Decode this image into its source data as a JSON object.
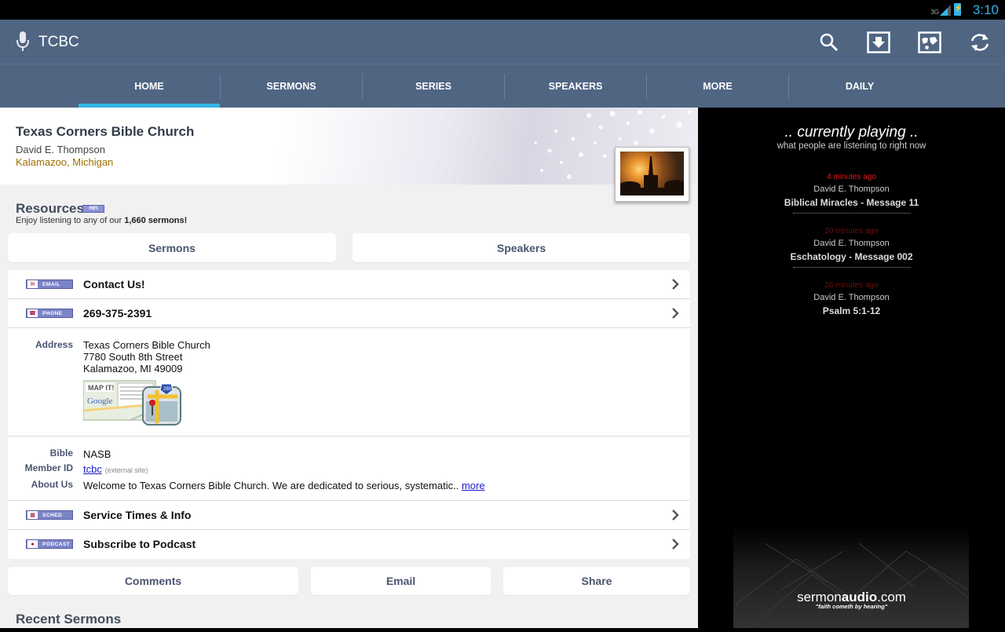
{
  "status": {
    "network": "3G",
    "time": "3:10"
  },
  "action_bar": {
    "title": "TCBC",
    "icons": [
      "mic-icon",
      "search-icon",
      "download-icon",
      "map-icon",
      "refresh-icon"
    ]
  },
  "tabs": [
    "HOME",
    "SERMONS",
    "SERIES",
    "SPEAKERS",
    "MORE",
    "DAILY"
  ],
  "active_tab": "HOME",
  "header": {
    "church_name": "Texas Corners Bible Church",
    "pastor": "David E. Thompson",
    "location": "Kalamazoo, Michigan"
  },
  "resources": {
    "title": "Resources",
    "badge": "HIFI",
    "subtitle_prefix": "Enjoy listening to any of our ",
    "subtitle_count": "1,660 sermons!",
    "buttons": {
      "sermons": "Sermons",
      "speakers": "Speakers"
    }
  },
  "rows": {
    "contact": {
      "badge": "EMAIL",
      "text": "Contact Us!"
    },
    "phone": {
      "badge": "PHONE",
      "text": "269-375-2391"
    },
    "service": {
      "badge": "SCHED",
      "text": "Service Times & Info"
    },
    "podcast": {
      "badge": "PODCAST",
      "text": "Subscribe to Podcast"
    }
  },
  "details": {
    "address_label": "Address",
    "address_lines": [
      "Texas Corners Bible Church",
      "7780 South 8th Street",
      "Kalamazoo, MI 49009"
    ],
    "map_label": "MAP IT!",
    "map_brand": "Google",
    "map_route": "280",
    "bible_label": "Bible",
    "bible_value": "NASB",
    "member_label": "Member ID",
    "member_value": "tcbc",
    "member_note": "(external site)",
    "about_label": "About Us",
    "about_text": "Welcome to Texas Corners Bible Church. We are dedicated to serious, systematic.. ",
    "about_more": "more"
  },
  "bottom_buttons": {
    "comments": "Comments",
    "email": "Email",
    "share": "Share"
  },
  "recent_title": "Recent Sermons",
  "currently_playing": {
    "title": ".. currently playing ..",
    "subtitle": "what people are listening to right now",
    "items": [
      {
        "time": "4 minutes ago",
        "speaker": "David E. Thompson",
        "title": "Biblical Miracles - Message 11"
      },
      {
        "time": "20 minutes ago",
        "speaker": "David E. Thompson",
        "title": "Eschatology - Message 002"
      },
      {
        "time": "26 minutes ago",
        "speaker": "David E. Thompson",
        "title": "Psalm 5:1-12"
      }
    ]
  },
  "logo": {
    "prefix": "sermon",
    "bold": "audio",
    "suffix": ".com",
    "tagline": "\"faith cometh by hearing\""
  },
  "colors": {
    "action_bar": "#4f6582",
    "tab_indicator": "#33b5e5",
    "label": "#4a5470",
    "location": "#a07000",
    "time_red": "#e21b1b"
  }
}
